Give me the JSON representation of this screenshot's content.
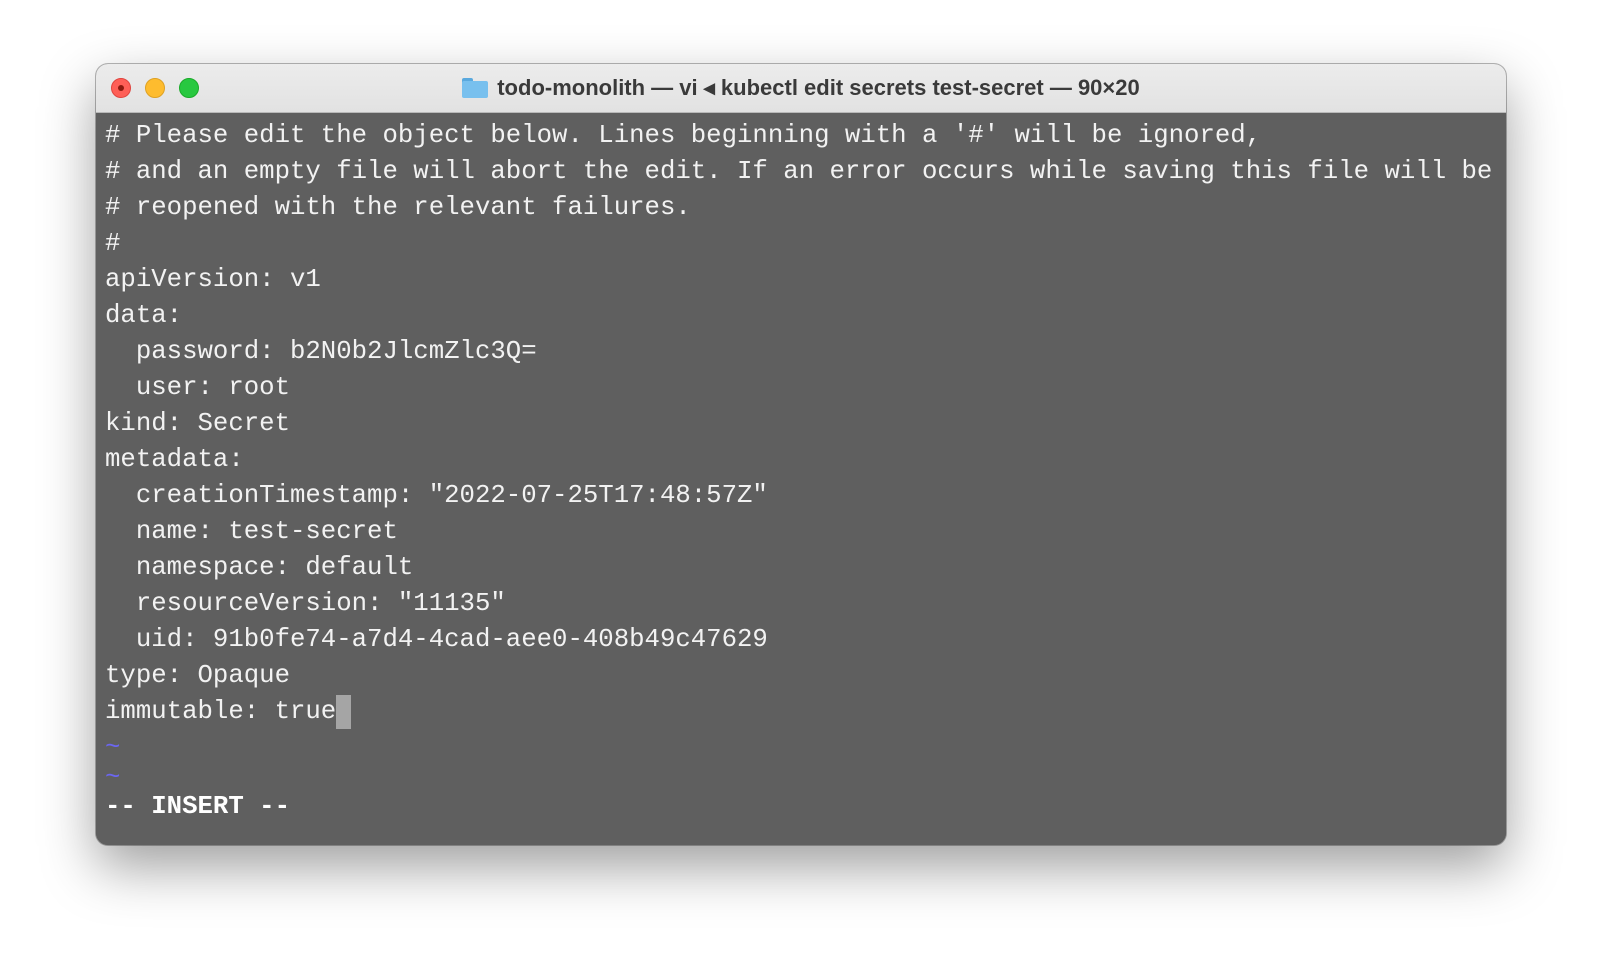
{
  "window": {
    "title": "todo-monolith — vi ◂ kubectl edit secrets test-secret — 90×20"
  },
  "editor": {
    "lines": [
      "# Please edit the object below. Lines beginning with a '#' will be ignored,",
      "# and an empty file will abort the edit. If an error occurs while saving this file will be",
      "# reopened with the relevant failures.",
      "#",
      "apiVersion: v1",
      "data:",
      "  password: b2N0b2JlcmZlc3Q=",
      "  user: root",
      "kind: Secret",
      "metadata:",
      "  creationTimestamp: \"2022-07-25T17:48:57Z\"",
      "  name: test-secret",
      "  namespace: default",
      "  resourceVersion: \"11135\"",
      "  uid: 91b0fe74-a7d4-4cad-aee0-408b49c47629",
      "type: Opaque",
      "immutable: true"
    ],
    "empty_line_markers": [
      "~",
      "~"
    ],
    "mode_indicator": "-- INSERT --"
  },
  "colors": {
    "terminal_background": "#5f5f5f",
    "text": "#f2f2f2",
    "tilde": "#6b66f0",
    "cursor": "#a5a5a5"
  },
  "icons": {
    "title_icon": "folder-icon"
  }
}
